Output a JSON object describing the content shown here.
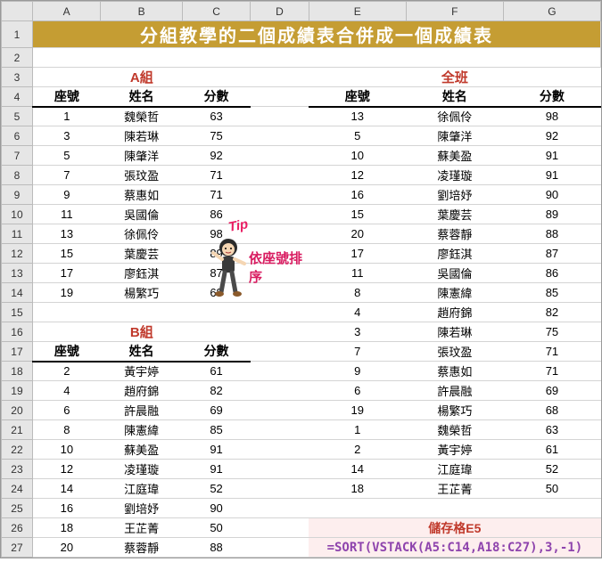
{
  "cols": [
    "A",
    "B",
    "C",
    "D",
    "E",
    "F",
    "G"
  ],
  "row_start": 1,
  "row_end": 27,
  "title": "分組教學的二個成績表合併成一個成績表",
  "groupA_title": "A組",
  "groupB_title": "B組",
  "all_title": "全班",
  "headers": {
    "seat": "座號",
    "name": "姓名",
    "score": "分數"
  },
  "groupA": [
    {
      "seat": 1,
      "name": "魏榮哲",
      "score": 63
    },
    {
      "seat": 3,
      "name": "陳若琳",
      "score": 75
    },
    {
      "seat": 5,
      "name": "陳肇洋",
      "score": 92
    },
    {
      "seat": 7,
      "name": "張玟盈",
      "score": 71
    },
    {
      "seat": 9,
      "name": "蔡惠如",
      "score": 71
    },
    {
      "seat": 11,
      "name": "吳國倫",
      "score": 86
    },
    {
      "seat": 13,
      "name": "徐佩伶",
      "score": 98
    },
    {
      "seat": 15,
      "name": "葉慶芸",
      "score": 89
    },
    {
      "seat": 17,
      "name": "廖鈺淇",
      "score": 87
    },
    {
      "seat": 19,
      "name": "楊繁巧",
      "score": 68
    }
  ],
  "groupB": [
    {
      "seat": 2,
      "name": "黃宇婷",
      "score": 61
    },
    {
      "seat": 4,
      "name": "趙府錦",
      "score": 82
    },
    {
      "seat": 6,
      "name": "許晨融",
      "score": 69
    },
    {
      "seat": 8,
      "name": "陳憲緯",
      "score": 85
    },
    {
      "seat": 10,
      "name": "蘇美盈",
      "score": 91
    },
    {
      "seat": 12,
      "name": "凌瑾璇",
      "score": 91
    },
    {
      "seat": 14,
      "name": "江庭瑋",
      "score": 52
    },
    {
      "seat": 16,
      "name": "劉培妤",
      "score": 90
    },
    {
      "seat": 18,
      "name": "王芷菁",
      "score": 50
    },
    {
      "seat": 20,
      "name": "蔡蓉靜",
      "score": 88
    }
  ],
  "all": [
    {
      "seat": 13,
      "name": "徐佩伶",
      "score": 98
    },
    {
      "seat": 5,
      "name": "陳肇洋",
      "score": 92
    },
    {
      "seat": 10,
      "name": "蘇美盈",
      "score": 91
    },
    {
      "seat": 12,
      "name": "凌瑾璇",
      "score": 91
    },
    {
      "seat": 16,
      "name": "劉培妤",
      "score": 90
    },
    {
      "seat": 15,
      "name": "葉慶芸",
      "score": 89
    },
    {
      "seat": 20,
      "name": "蔡蓉靜",
      "score": 88
    },
    {
      "seat": 17,
      "name": "廖鈺淇",
      "score": 87
    },
    {
      "seat": 11,
      "name": "吳國倫",
      "score": 86
    },
    {
      "seat": 8,
      "name": "陳憲緯",
      "score": 85
    },
    {
      "seat": 4,
      "name": "趙府錦",
      "score": 82
    },
    {
      "seat": 3,
      "name": "陳若琳",
      "score": 75
    },
    {
      "seat": 7,
      "name": "張玟盈",
      "score": 71
    },
    {
      "seat": 9,
      "name": "蔡惠如",
      "score": 71
    },
    {
      "seat": 6,
      "name": "許晨融",
      "score": 69
    },
    {
      "seat": 19,
      "name": "楊繁巧",
      "score": 68
    },
    {
      "seat": 1,
      "name": "魏榮哲",
      "score": 63
    },
    {
      "seat": 2,
      "name": "黃宇婷",
      "score": 61
    },
    {
      "seat": 14,
      "name": "江庭瑋",
      "score": 52
    },
    {
      "seat": 18,
      "name": "王芷菁",
      "score": 50
    }
  ],
  "tip_label": "Tip",
  "sort_note": "依座號排序",
  "formula_cell_label": "儲存格E5",
  "formula_text": "=SORT(VSTACK(A5:C14,A18:C27),3,-1)"
}
